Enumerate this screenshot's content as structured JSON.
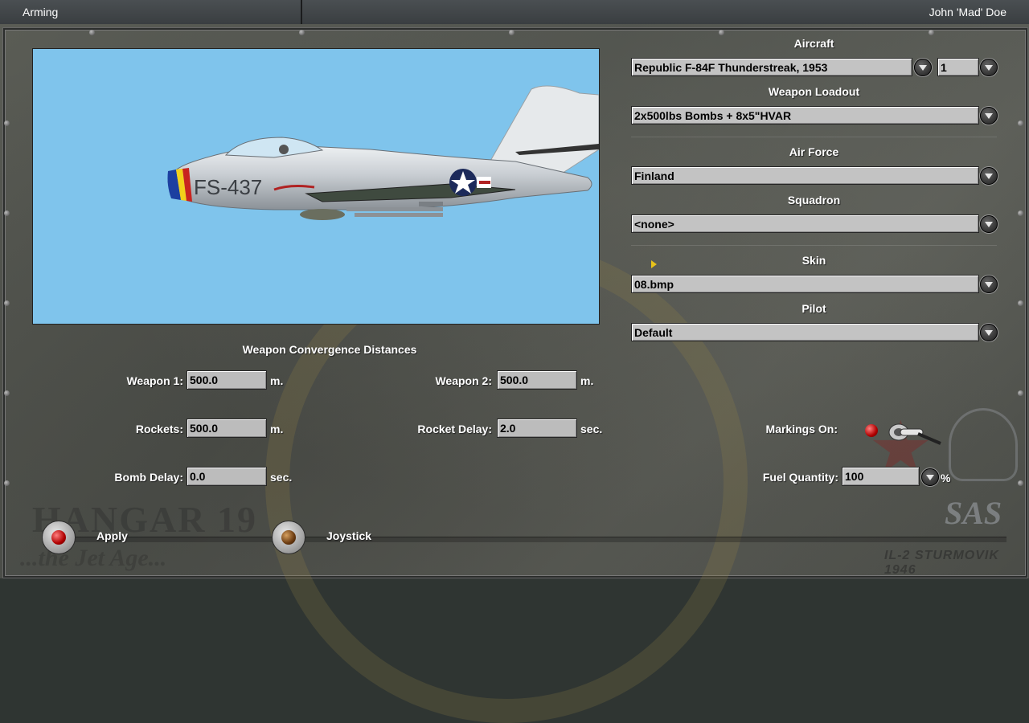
{
  "topbar": {
    "title": "Arming",
    "pilot": "John 'Mad' Doe"
  },
  "preview": {
    "tail_code": "FS-437"
  },
  "right": {
    "aircraft_label": "Aircraft",
    "aircraft_value": "Republic F-84F Thunderstreak, 1953",
    "aircraft_count": "1",
    "loadout_label": "Weapon Loadout",
    "loadout_value": "2x500lbs Bombs + 8x5\"HVAR",
    "airforce_label": "Air Force",
    "airforce_value": "Finland",
    "squadron_label": "Squadron",
    "squadron_value": "<none>",
    "skin_label": "Skin",
    "skin_value": "08.bmp",
    "pilot_label": "Pilot",
    "pilot_value": "Default"
  },
  "convergence": {
    "title": "Weapon Convergence Distances",
    "weapon1_label": "Weapon 1:",
    "weapon1_value": "500.0",
    "weapon2_label": "Weapon 2:",
    "weapon2_value": "500.0",
    "rockets_label": "Rockets:",
    "rockets_value": "500.0",
    "rocket_delay_label": "Rocket Delay:",
    "rocket_delay_value": "2.0",
    "bomb_delay_label": "Bomb Delay:",
    "bomb_delay_value": "0.0",
    "unit_m": "m.",
    "unit_sec": "sec."
  },
  "options": {
    "markings_label": "Markings On:",
    "markings_on": true,
    "fuel_label": "Fuel Quantity:",
    "fuel_value": "100",
    "fuel_unit": "%"
  },
  "buttons": {
    "apply_label": "Apply",
    "joystick_label": "Joystick"
  },
  "watermarks": {
    "hangar": "HANGAR 19",
    "jet_age": "...the Jet Age...",
    "sas": "SAS",
    "game": "IL-2 STURMOVIK 1946"
  },
  "colors": {
    "sky": "#7fc4ec",
    "field": "#bcbcbc",
    "text": "#ffffff",
    "lamp_red": "#b00000"
  }
}
